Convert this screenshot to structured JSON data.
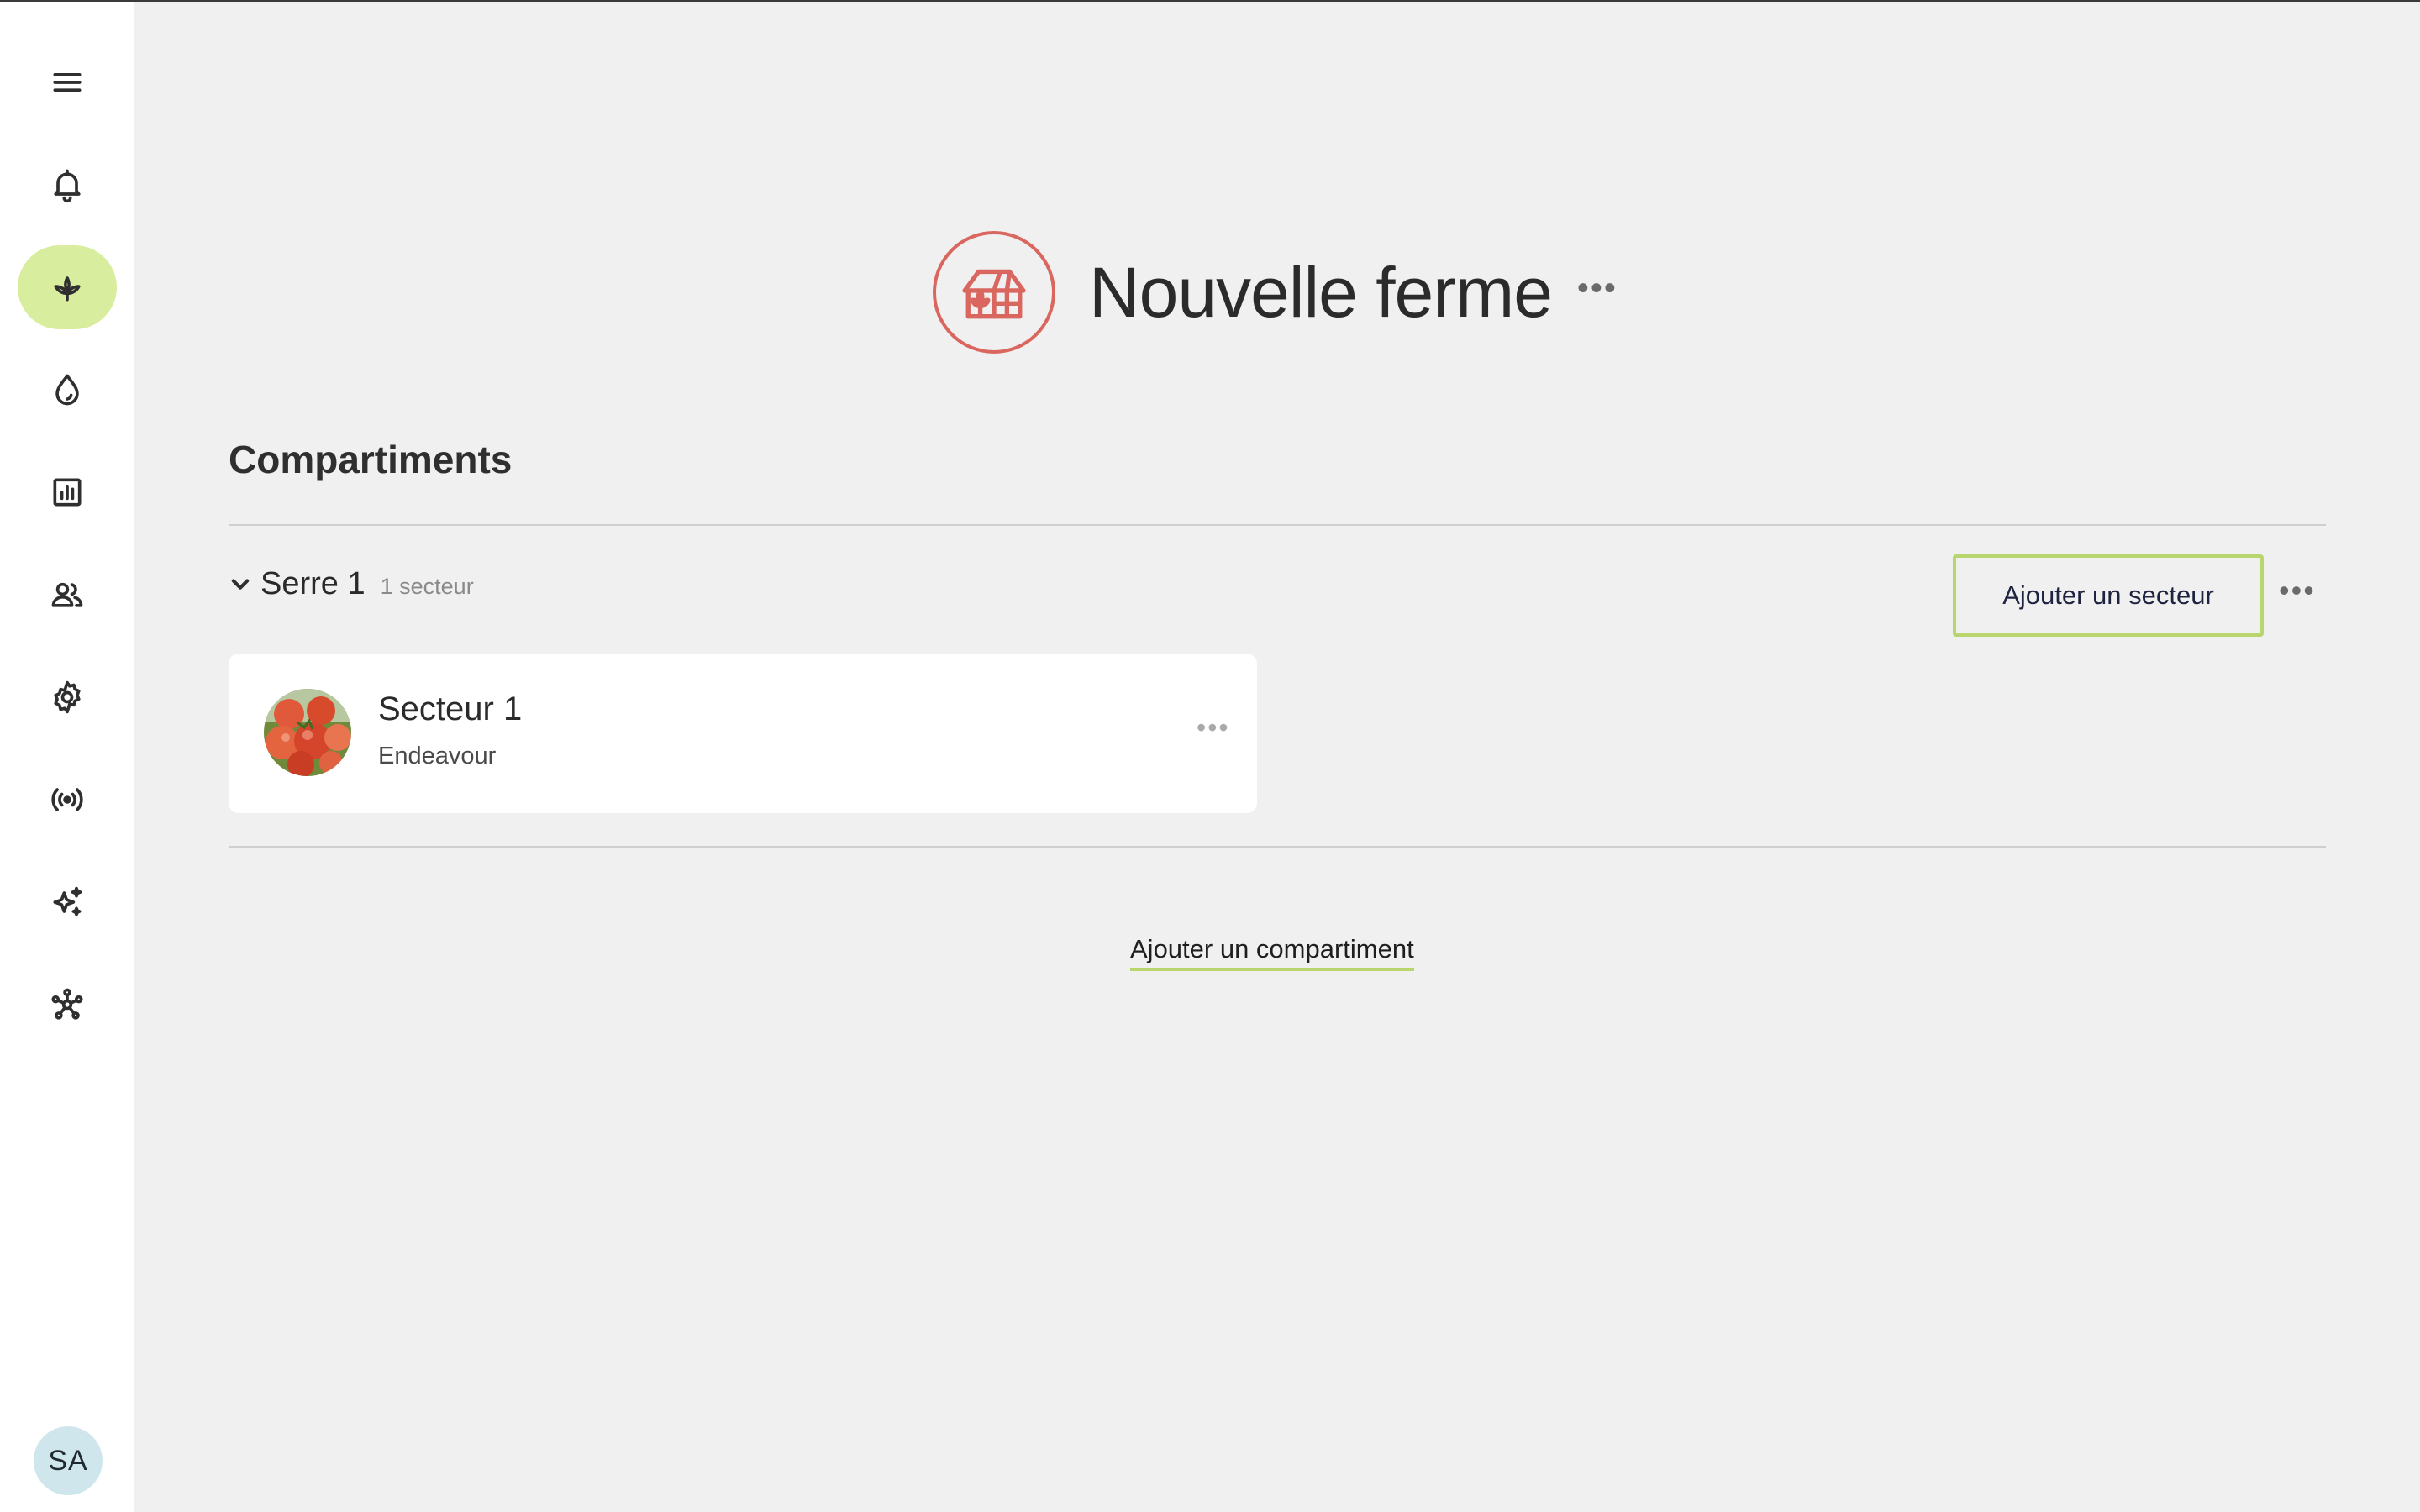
{
  "sidebar": {
    "items": [
      {
        "icon": "menu-icon"
      },
      {
        "icon": "bell-icon"
      },
      {
        "icon": "sprout-icon",
        "active": true
      },
      {
        "icon": "water-drop-icon"
      },
      {
        "icon": "bar-chart-icon"
      },
      {
        "icon": "users-icon"
      },
      {
        "icon": "gear-icon"
      },
      {
        "icon": "broadcast-icon"
      },
      {
        "icon": "sparkles-icon"
      },
      {
        "icon": "network-icon"
      }
    ],
    "avatar_initials": "SA",
    "active_color": "#d8ee9e"
  },
  "farm": {
    "title": "Nouvelle ferme",
    "icon": "greenhouse-icon",
    "icon_color": "#d9675f",
    "more": "•••"
  },
  "compartments": {
    "section_title": "Compartiments",
    "add_compartment_label": "Ajouter un compartiment",
    "groups": [
      {
        "name": "Serre 1",
        "count_label": "1 secteur",
        "add_sector_label": "Ajouter un secteur",
        "more": "•••",
        "sectors": [
          {
            "name": "Secteur 1",
            "variety": "Endeavour",
            "photo": "tomato-photo",
            "more": "•••"
          }
        ]
      }
    ]
  },
  "colors": {
    "accent_green": "#b8d56e",
    "chat_button": "#3b8fa8",
    "background": "#f0f0f0"
  },
  "chat": {
    "icon": "chat-bubbles-icon"
  }
}
